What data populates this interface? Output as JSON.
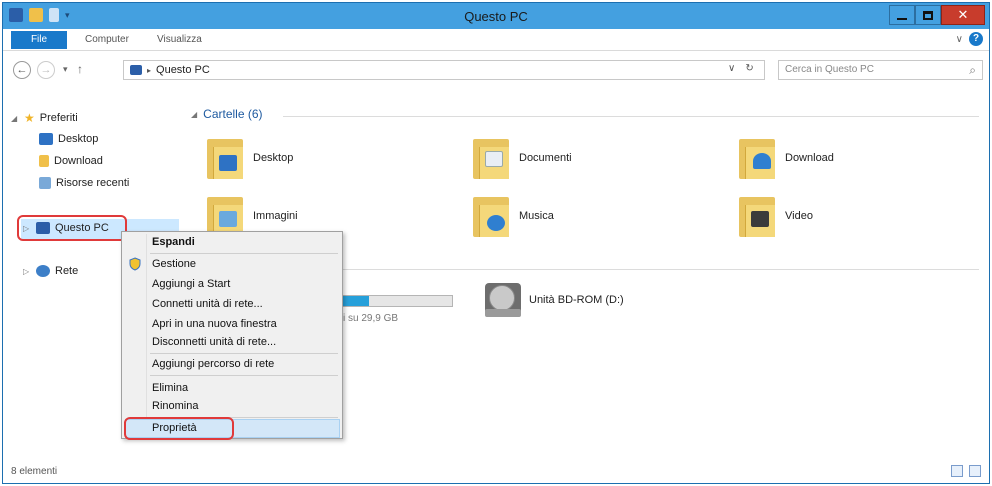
{
  "window": {
    "title": "Questo PC"
  },
  "ribbon": {
    "file": "File",
    "tabs": [
      "Computer",
      "Visualizza"
    ]
  },
  "address": {
    "path_segment": "Questo PC",
    "search_placeholder": "Cerca in Questo PC"
  },
  "nav": {
    "preferiti": "Preferiti",
    "desktop": "Desktop",
    "download": "Download",
    "risorse_recenti": "Risorse recenti",
    "questo_pc": "Questo PC",
    "rete": "Rete"
  },
  "content": {
    "folders_header": "Cartelle (6)",
    "folders": [
      "Desktop",
      "Documenti",
      "Download",
      "Immagini",
      "Musica",
      "Video"
    ],
    "drive_partial_label": "bili su 29,9 GB",
    "drive_usage_fraction": 0.3,
    "bd_rom": "Unità BD-ROM (D:)"
  },
  "context_menu": {
    "items": [
      "Espandi",
      "Gestione",
      "Aggiungi a Start",
      "Connetti unità di rete...",
      "Apri in una nuova finestra",
      "Disconnetti unità di rete...",
      "Aggiungi percorso di rete",
      "Elimina",
      "Rinomina",
      "Proprietà"
    ]
  },
  "status": {
    "count": "8 elementi"
  },
  "colors": {
    "accent": "#1979ca",
    "titlebar": "#44a0e0",
    "highlight": "#e03a3a",
    "close": "#c83c2c"
  }
}
